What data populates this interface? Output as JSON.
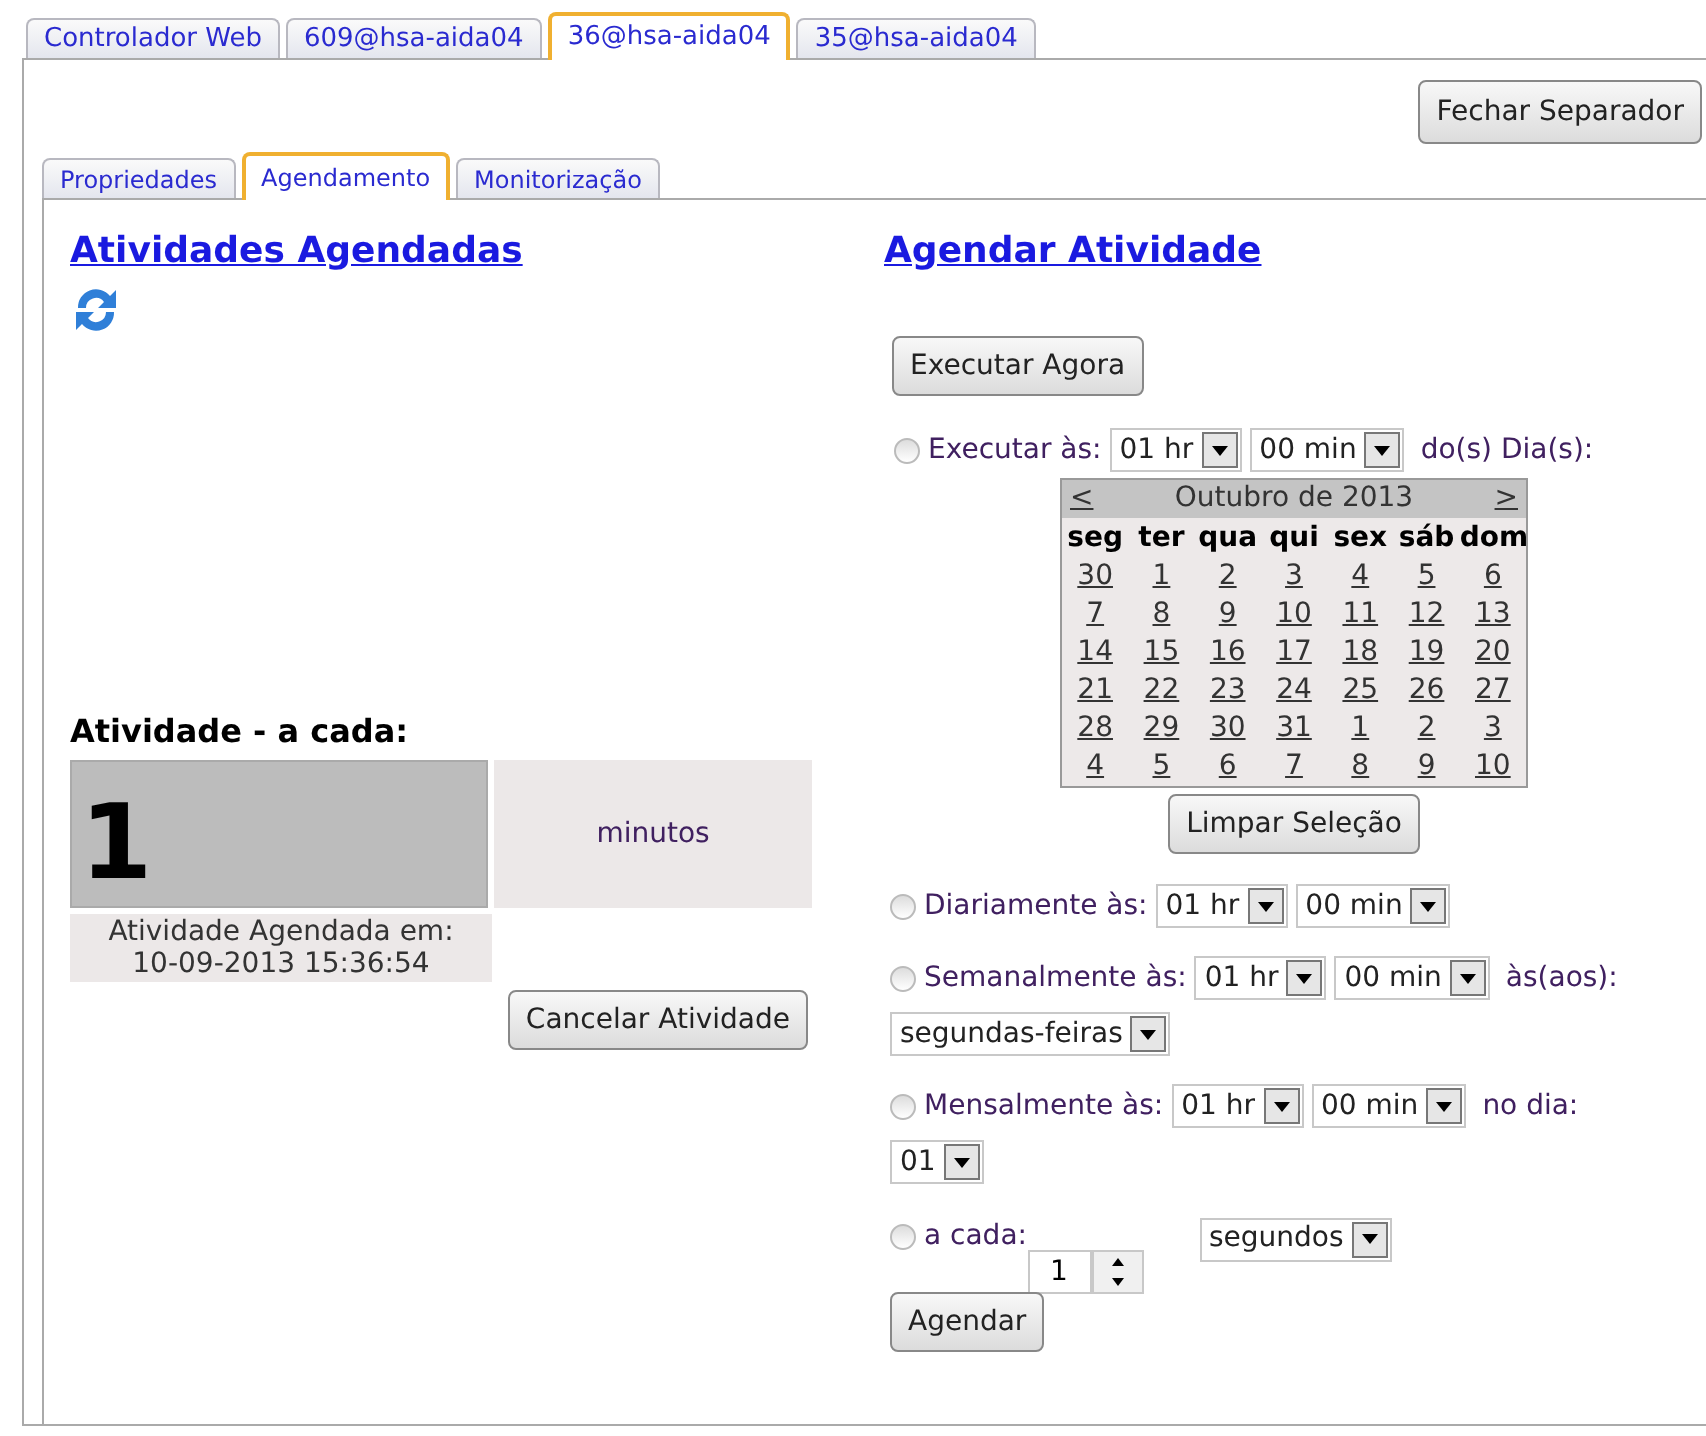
{
  "top_tabs": [
    {
      "label": "Controlador Web",
      "selected": false
    },
    {
      "label": "609@hsa-aida04",
      "selected": false
    },
    {
      "label": "36@hsa-aida04",
      "selected": true
    },
    {
      "label": "35@hsa-aida04",
      "selected": false
    }
  ],
  "close_button": "Fechar Separador",
  "sub_tabs": [
    {
      "label": "Propriedades",
      "selected": false
    },
    {
      "label": "Agendamento",
      "selected": true
    },
    {
      "label": "Monitorização",
      "selected": false
    }
  ],
  "scheduled": {
    "title": "Atividades Agendadas",
    "activity_label": "Atividade - a cada:",
    "value": "1",
    "unit": "minutos",
    "scheduled_at_label": "Atividade Agendada em:",
    "scheduled_at": "10-09-2013 15:36:54",
    "cancel_button": "Cancelar Atividade"
  },
  "schedule": {
    "title": "Agendar Atividade",
    "run_now_button": "Executar Agora",
    "options": [
      {
        "kind": "days",
        "label": "Executar às:",
        "selected": false,
        "hour": "01 hr",
        "minute": "00 min",
        "suffix": "do(s) Dia(s):"
      },
      {
        "kind": "daily",
        "label": "Diariamente às:",
        "selected": false,
        "hour": "01 hr",
        "minute": "00 min"
      },
      {
        "kind": "weekly",
        "label": "Semanalmente às:",
        "selected": false,
        "hour": "01 hr",
        "minute": "00 min",
        "suffix": "às(aos):",
        "extra": "segundas-feiras"
      },
      {
        "kind": "monthly",
        "label": "Mensalmente às:",
        "selected": false,
        "hour": "01 hr",
        "minute": "00 min",
        "suffix": "no dia:",
        "extra": "01"
      },
      {
        "kind": "interval",
        "label": "a cada:",
        "selected": false,
        "count": "1",
        "unit": "segundos"
      }
    ],
    "calendar": {
      "prev": "<",
      "month": "Outubro de 2013",
      "next": ">",
      "weekdays": [
        "seg",
        "ter",
        "qua",
        "qui",
        "sex",
        "sáb",
        "dom"
      ],
      "weeks": [
        [
          "30",
          "1",
          "2",
          "3",
          "4",
          "5",
          "6"
        ],
        [
          "7",
          "8",
          "9",
          "10",
          "11",
          "12",
          "13"
        ],
        [
          "14",
          "15",
          "16",
          "17",
          "18",
          "19",
          "20"
        ],
        [
          "21",
          "22",
          "23",
          "24",
          "25",
          "26",
          "27"
        ],
        [
          "28",
          "29",
          "30",
          "31",
          "1",
          "2",
          "3"
        ],
        [
          "4",
          "5",
          "6",
          "7",
          "8",
          "9",
          "10"
        ]
      ]
    },
    "clear_button": "Limpar Seleção",
    "submit_button": "Agendar"
  }
}
